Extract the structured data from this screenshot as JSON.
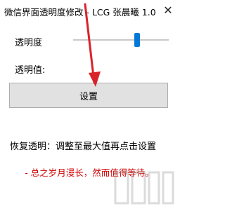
{
  "window": {
    "title": "微信界面透明度修改 - LCG 张晨曦 1.0",
    "close_icon": "close-icon"
  },
  "opacity": {
    "label": "透明度",
    "slider_level": 0.67
  },
  "value_label": "透明值:",
  "set_button": "设置",
  "hint": "恢复透明：调整至最大值再点击设置",
  "quote": "- 总之岁月漫长，然而值得等待。",
  "colors": {
    "accent": "#0078d7",
    "quote": "#d00000",
    "arrow": "#d8232a"
  }
}
